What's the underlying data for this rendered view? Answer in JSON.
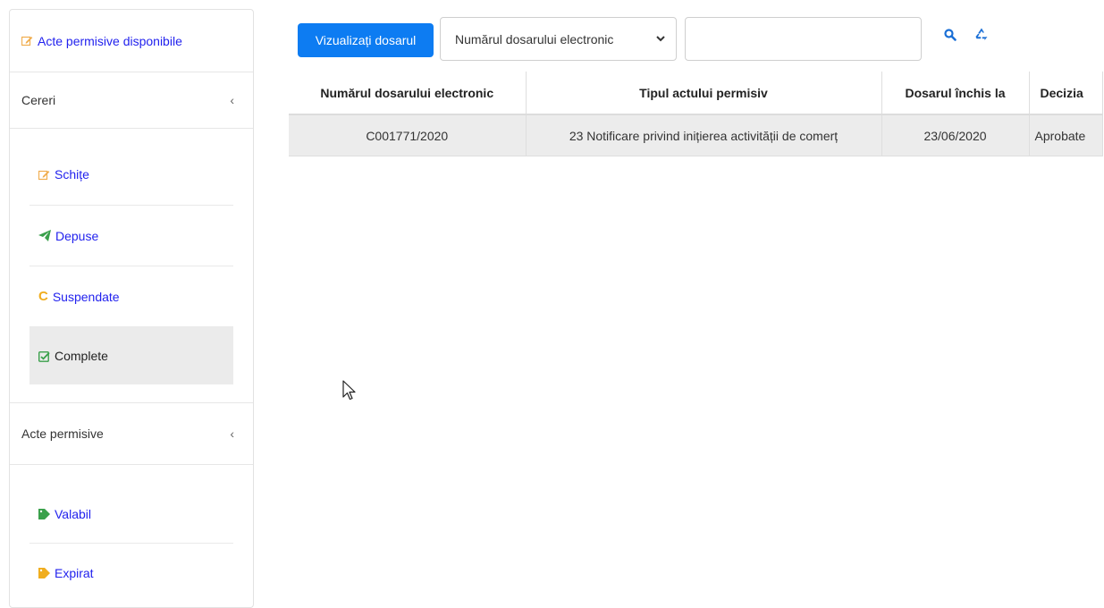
{
  "sidebar": {
    "available_link": "Acte permisive disponibile",
    "requests_section": "Cereri",
    "requests_items": [
      {
        "label": "Schițe",
        "icon": "edit-icon",
        "color": "#f0ad4e"
      },
      {
        "label": "Depuse",
        "icon": "send-icon",
        "color": "#3aa04b"
      },
      {
        "label": "Suspendate",
        "icon": "refresh-icon",
        "color": "#f0ad1e"
      },
      {
        "label": "Complete",
        "icon": "check-square-icon",
        "color": "#3aa04b",
        "active": true
      }
    ],
    "permits_section": "Acte permisive",
    "permits_items": [
      {
        "label": "Valabil",
        "icon": "tag-icon",
        "color": "#3aa04b"
      },
      {
        "label": "Expirat",
        "icon": "tag-icon",
        "color": "#f0ad1e"
      }
    ]
  },
  "toolbar": {
    "view_button": "Vizualizați dosarul",
    "select_value": "Numărul dosarului electronic",
    "search_value": "",
    "accent_color": "#0d7cf2"
  },
  "table": {
    "headers": [
      "Numărul dosarului electronic",
      "Tipul actului permisiv",
      "Dosarul închis la",
      "Decizia"
    ],
    "rows": [
      [
        "C001771/2020",
        "23 Notificare privind inițierea activității de comerț",
        "23/06/2020",
        "Aprobate"
      ]
    ]
  }
}
